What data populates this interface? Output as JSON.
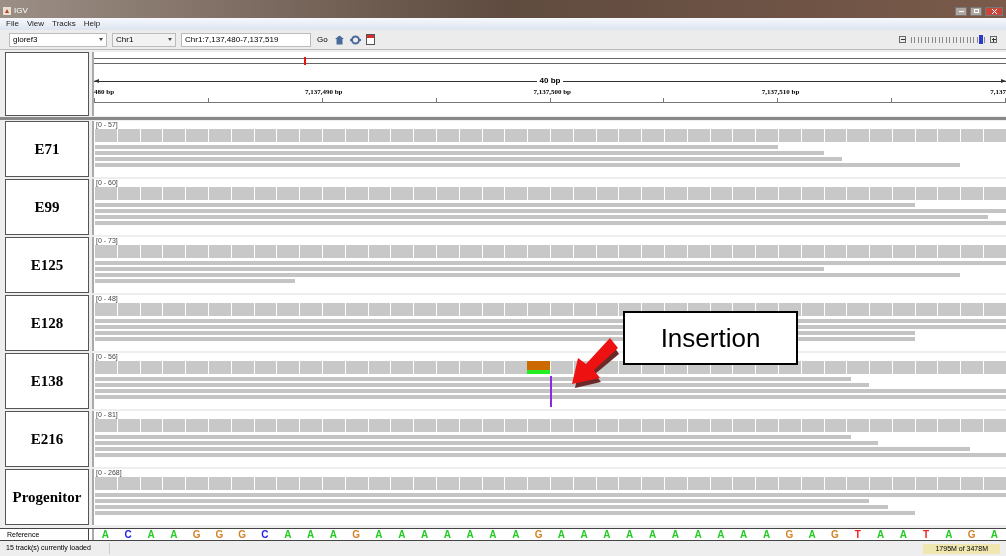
{
  "window": {
    "title": "IGV"
  },
  "menu": [
    "File",
    "View",
    "Tracks",
    "Help"
  ],
  "toolbar": {
    "genome": "gloref3",
    "chromosome": "Chr1",
    "locus": "Chr1:7,137,480-7,137,519",
    "go": "Go",
    "zoom": {
      "level": 0.94
    }
  },
  "ruler": {
    "span": "40 bp",
    "ticks": [
      "480 bp",
      "7,137,490 bp",
      "7,137,500 bp",
      "7,137,510 bp",
      "7,137"
    ]
  },
  "tracks": [
    {
      "name": "E71",
      "range": "[0 - 57]",
      "insertion": false
    },
    {
      "name": "E99",
      "range": "[0 - 60]",
      "insertion": false
    },
    {
      "name": "E125",
      "range": "[0 - 73]",
      "insertion": false
    },
    {
      "name": "E128",
      "range": "[0 - 48]",
      "insertion": false
    },
    {
      "name": "E138",
      "range": "[0 - 56]",
      "insertion": true
    },
    {
      "name": "E216",
      "range": "[0 - 81]",
      "insertion": false
    },
    {
      "name": "Progenitor",
      "range": "[0 - 268]",
      "insertion": false
    }
  ],
  "reference": {
    "label": "Reference",
    "bases": [
      {
        "base": "A",
        "color": "#22cc22"
      },
      {
        "base": "C",
        "color": "#2222ee"
      },
      {
        "base": "A",
        "color": "#22cc22"
      },
      {
        "base": "A",
        "color": "#22cc22"
      },
      {
        "base": "G",
        "color": "#d2822a"
      },
      {
        "base": "G",
        "color": "#d2822a"
      },
      {
        "base": "G",
        "color": "#d2822a"
      },
      {
        "base": "C",
        "color": "#2222ee"
      },
      {
        "base": "A",
        "color": "#22cc22"
      },
      {
        "base": "A",
        "color": "#22cc22"
      },
      {
        "base": "A",
        "color": "#22cc22"
      },
      {
        "base": "G",
        "color": "#d2822a"
      },
      {
        "base": "A",
        "color": "#22cc22"
      },
      {
        "base": "A",
        "color": "#22cc22"
      },
      {
        "base": "A",
        "color": "#22cc22"
      },
      {
        "base": "A",
        "color": "#22cc22"
      },
      {
        "base": "A",
        "color": "#22cc22"
      },
      {
        "base": "A",
        "color": "#22cc22"
      },
      {
        "base": "A",
        "color": "#22cc22"
      },
      {
        "base": "G",
        "color": "#d2822a"
      },
      {
        "base": "A",
        "color": "#22cc22"
      },
      {
        "base": "A",
        "color": "#22cc22"
      },
      {
        "base": "A",
        "color": "#22cc22"
      },
      {
        "base": "A",
        "color": "#22cc22"
      },
      {
        "base": "A",
        "color": "#22cc22"
      },
      {
        "base": "A",
        "color": "#22cc22"
      },
      {
        "base": "A",
        "color": "#22cc22"
      },
      {
        "base": "A",
        "color": "#22cc22"
      },
      {
        "base": "A",
        "color": "#22cc22"
      },
      {
        "base": "A",
        "color": "#22cc22"
      },
      {
        "base": "G",
        "color": "#d2822a"
      },
      {
        "base": "A",
        "color": "#22cc22"
      },
      {
        "base": "G",
        "color": "#d2822a"
      },
      {
        "base": "T",
        "color": "#ee2222"
      },
      {
        "base": "A",
        "color": "#22cc22"
      },
      {
        "base": "A",
        "color": "#22cc22"
      },
      {
        "base": "T",
        "color": "#ee2222"
      },
      {
        "base": "A",
        "color": "#22cc22"
      },
      {
        "base": "G",
        "color": "#d2822a"
      },
      {
        "base": "A",
        "color": "#22cc22"
      }
    ]
  },
  "callout": {
    "text": "Insertion"
  },
  "status": {
    "message": "15 track(s) currently loaded",
    "memory": "1795M of 3478M"
  }
}
